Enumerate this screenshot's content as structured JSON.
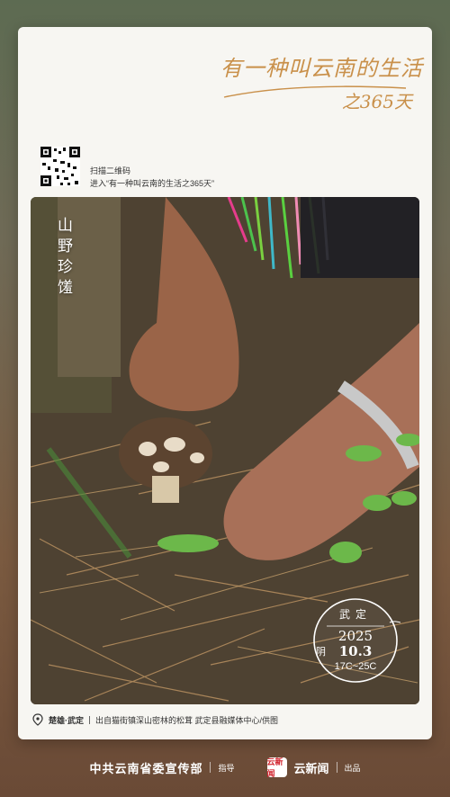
{
  "poster": {
    "slogan_line1": "有一种叫云南的生活",
    "slogan_line2": "之365天",
    "scan_line1": "扫描二维码",
    "scan_line2": "进入“有一种叫云南的生活之365天”",
    "photo_title": "山野珍馐",
    "stamp": {
      "place": "武定",
      "year": "2025",
      "date": "10.3",
      "weather": "阴",
      "temperature": "17C~25C"
    },
    "caption": {
      "region": "楚雄·武定",
      "text": "出自猫街镇深山密林的松茸  武定县融媒体中心/供图"
    }
  },
  "footer": {
    "organizer": "中共云南省委宣传部",
    "guide_label": "指导",
    "brand": "云新闻",
    "logo_text": "云新闻",
    "produce_label": "出品"
  },
  "colors": {
    "slogan": "#c9904a",
    "card": "#f7f6f2",
    "brand_red": "#d0202a"
  }
}
